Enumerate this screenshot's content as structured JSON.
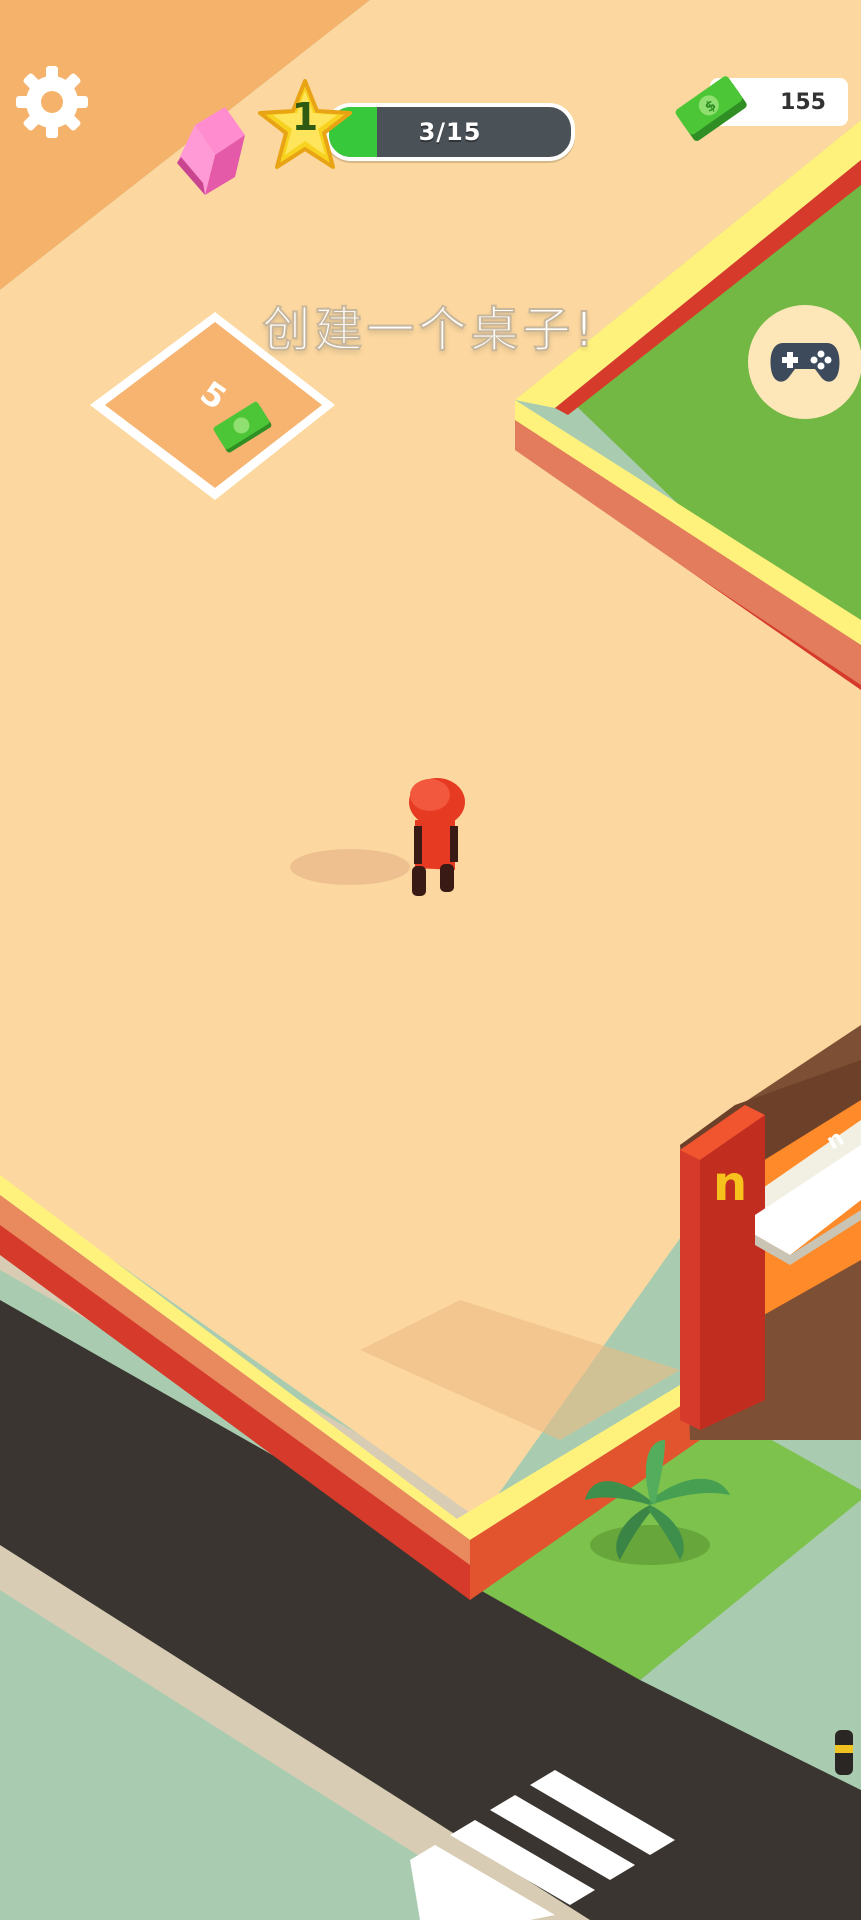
{
  "hud": {
    "level": "1",
    "progress_text": "3/15",
    "progress_fraction": 0.2,
    "money": "155"
  },
  "instruction": "创建一个桌子!",
  "build_pad": {
    "cost": "5"
  },
  "storefront": {
    "logo": "n",
    "sign_text": "n"
  },
  "icons": {
    "settings": "gear-icon",
    "eraser": "eraser-icon",
    "level_star": "star-icon",
    "money": "cash-icon",
    "gamepad": "gamepad-icon"
  },
  "colors": {
    "floor": "#fcd8a0",
    "grass": "#73b844",
    "wall_red": "#d63a2a",
    "wall_yellow": "#fff27c",
    "road": "#3a3530",
    "sidewalk": "#a9ccb0",
    "progress_green": "#37c83b",
    "progress_track": "#4a5157",
    "star_yellow": "#f7d320",
    "cash_green": "#4cc636",
    "player_red": "#e63a22"
  }
}
